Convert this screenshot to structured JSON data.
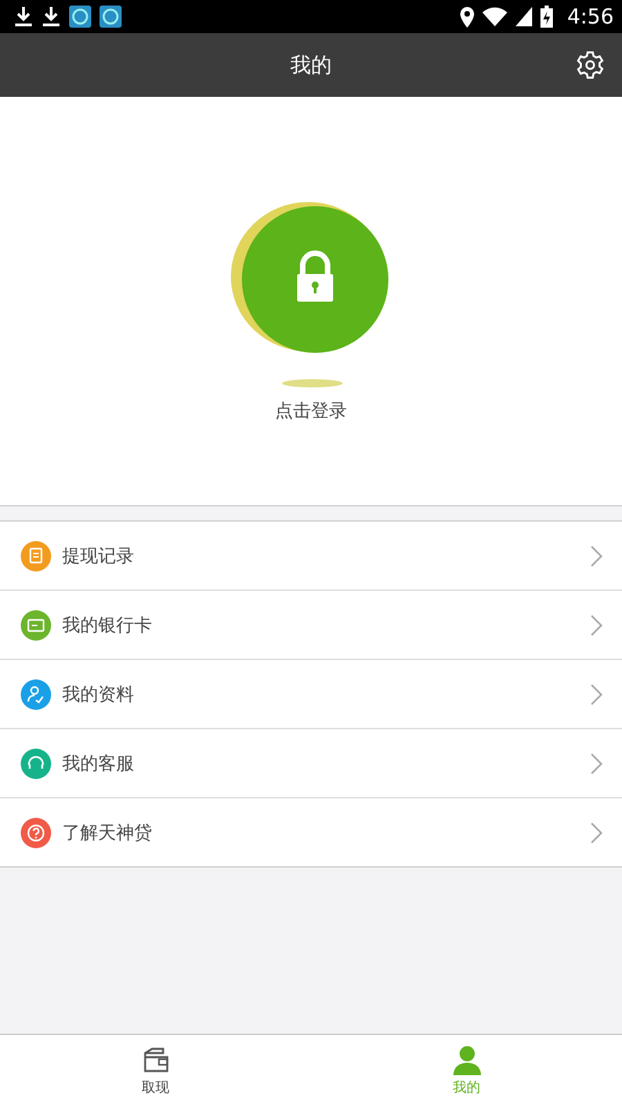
{
  "status_bar": {
    "time": "4:56"
  },
  "header": {
    "title": "我的"
  },
  "profile": {
    "login_label": "点击登录"
  },
  "menu": [
    {
      "label": "提现记录",
      "kind": "records",
      "color": "#f29c1f"
    },
    {
      "label": "我的银行卡",
      "kind": "card",
      "color": "#6cb52d"
    },
    {
      "label": "我的资料",
      "kind": "profile",
      "color": "#1aa0e6"
    },
    {
      "label": "我的客服",
      "kind": "service",
      "color": "#16b38a"
    },
    {
      "label": "了解天神贷",
      "kind": "about",
      "color": "#f05a47"
    }
  ],
  "tab_bar": [
    {
      "label": "取现",
      "kind": "wallet",
      "selected": false
    },
    {
      "label": "我的",
      "kind": "person",
      "selected": true
    }
  ]
}
